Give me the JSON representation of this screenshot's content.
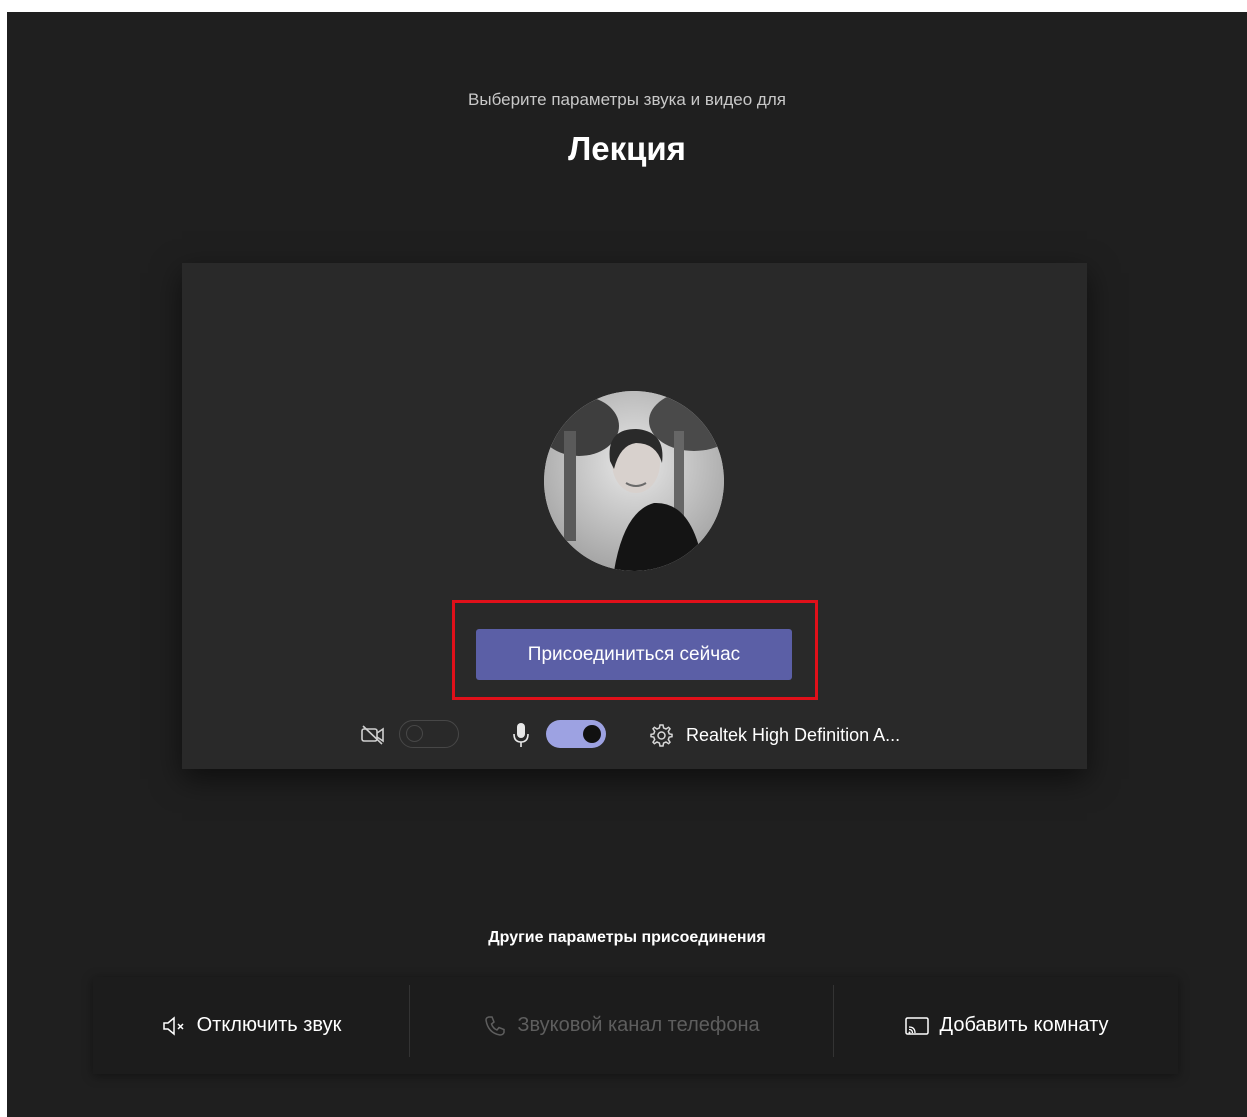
{
  "header": {
    "subtitle": "Выберите параметры звука и видео для",
    "meeting_title": "Лекция"
  },
  "preview": {
    "join_button_label": "Присоединиться сейчас",
    "camera_enabled": false,
    "mic_enabled": true,
    "audio_device": "Realtek High Definition A..."
  },
  "other_options": {
    "title": "Другие параметры присоединения",
    "items": [
      {
        "icon": "speaker-mute-icon",
        "label": "Отключить звук",
        "disabled": false
      },
      {
        "icon": "phone-icon",
        "label": "Звуковой канал телефона",
        "disabled": true
      },
      {
        "icon": "cast-room-icon",
        "label": "Добавить комнату",
        "disabled": false
      }
    ]
  },
  "colors": {
    "background": "#1f1f1f",
    "panel": "#292929",
    "accent": "#5b5fa6",
    "toggle_on": "#9da2e2",
    "highlight": "#e0101a"
  }
}
